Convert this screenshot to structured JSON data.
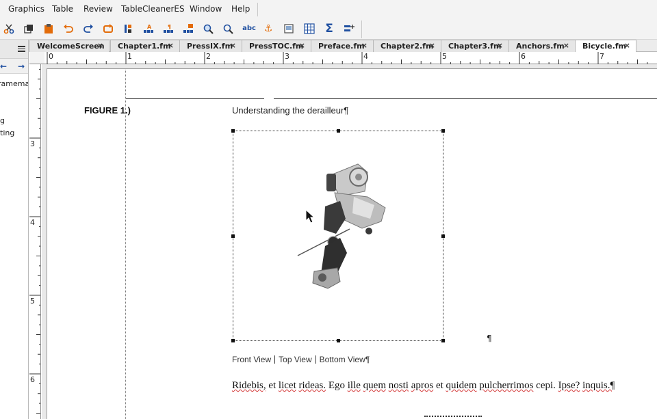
{
  "menubar": {
    "items": [
      "Graphics",
      "Table",
      "Review",
      "TableCleanerES",
      "Window",
      "Help"
    ]
  },
  "toolbar": {
    "icons": [
      "cut-icon",
      "copy-icon",
      "paste-icon",
      "undo-icon",
      "redo-icon",
      "repeat-icon",
      "paragraph-format-icon",
      "character-format-icon",
      "paragraph-mark-icon",
      "table-format-icon",
      "find-icon",
      "zoom-icon",
      "spelling-icon",
      "anchor-icon",
      "frame-icon",
      "table-icon",
      "sum-icon",
      "insert-variable-icon"
    ],
    "spelling_label": "abc",
    "sum_label": "Σ",
    "anchor_label": "⚓"
  },
  "left_panel": {
    "lines": [
      "ramemak",
      "g",
      "ting"
    ]
  },
  "tabs": [
    {
      "label": "WelcomeScreen",
      "active": false
    },
    {
      "label": "Chapter1.fm",
      "active": false
    },
    {
      "label": "PressIX.fm",
      "active": false
    },
    {
      "label": "PressTOC.fm",
      "active": false
    },
    {
      "label": "Preface.fm",
      "active": false
    },
    {
      "label": "Chapter2.fm",
      "active": false
    },
    {
      "label": "Chapter3.fm",
      "active": false
    },
    {
      "label": "Anchors.fm",
      "active": false
    },
    {
      "label": "Bicycle.fm",
      "active": true
    }
  ],
  "tab_close": "×",
  "rulers": {
    "horizontal": [
      "0",
      "1",
      "2",
      "3",
      "4",
      "5",
      "6",
      "7"
    ],
    "vertical": [
      "3",
      "4",
      "5",
      "6"
    ]
  },
  "document": {
    "figure_label": "FIGURE 1.)",
    "figure_title": "Understanding the derailleur¶",
    "frame_end_mark": "¶",
    "views": [
      "Front View",
      "Top View",
      "Bottom View¶"
    ],
    "body_text": [
      "Ridebis,",
      "et",
      "licet",
      "rideas.",
      "Ego",
      "ille",
      "quem",
      "nosti",
      "apros",
      "et",
      "quidem",
      "pulcherrimos",
      "cepi.",
      "Ipse?",
      "inquis.¶"
    ]
  },
  "colors": {
    "accent": "#e36c0a",
    "link_blue": "#1f4fa0"
  }
}
